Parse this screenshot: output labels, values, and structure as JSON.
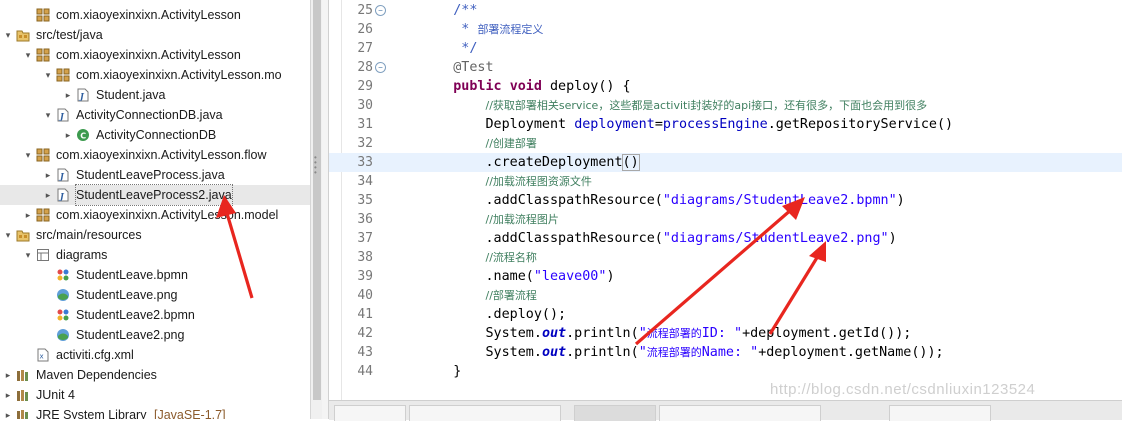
{
  "explorer": {
    "rows": [
      {
        "label": "com.xiaoyexinxixn.ActivityLesson",
        "suffix": "",
        "icon": "package-icon",
        "toggle": ""
      },
      {
        "label": "src/test/java",
        "suffix": "",
        "icon": "source-folder-icon",
        "toggle": "▾"
      },
      {
        "label": "com.xiaoyexinxixn.ActivityLesson",
        "suffix": "",
        "icon": "package-icon",
        "toggle": "▾"
      },
      {
        "label": "com.xiaoyexinxixn.ActivityLesson.mo",
        "suffix": "",
        "icon": "package-icon",
        "toggle": "▾"
      },
      {
        "label": "Student.java",
        "suffix": "",
        "icon": "java-file-icon",
        "toggle": "▸"
      },
      {
        "label": "ActivityConnectionDB.java",
        "suffix": "",
        "icon": "java-file-icon",
        "toggle": "▾"
      },
      {
        "label": "ActivityConnectionDB",
        "suffix": "",
        "icon": "class-icon",
        "toggle": "▸"
      },
      {
        "label": "com.xiaoyexinxixn.ActivityLesson.flow",
        "suffix": "",
        "icon": "package-icon",
        "toggle": "▾"
      },
      {
        "label": "StudentLeaveProcess.java",
        "suffix": "",
        "icon": "java-file-icon",
        "toggle": "▸"
      },
      {
        "label": "StudentLeaveProcess2.java",
        "suffix": "",
        "icon": "java-file-icon",
        "toggle": "▸"
      },
      {
        "label": "com.xiaoyexinxixn.ActivityLesson.model",
        "suffix": "",
        "icon": "package-icon",
        "toggle": "▸"
      },
      {
        "label": "src/main/resources",
        "suffix": "",
        "icon": "source-folder-icon",
        "toggle": "▾"
      },
      {
        "label": "diagrams",
        "suffix": "",
        "icon": "folder-icon",
        "toggle": "▾"
      },
      {
        "label": "StudentLeave.bpmn",
        "suffix": "",
        "icon": "bpmn-file-icon",
        "toggle": ""
      },
      {
        "label": "StudentLeave.png",
        "suffix": "",
        "icon": "image-file-icon",
        "toggle": ""
      },
      {
        "label": "StudentLeave2.bpmn",
        "suffix": "",
        "icon": "bpmn-file-icon",
        "toggle": ""
      },
      {
        "label": "StudentLeave2.png",
        "suffix": "",
        "icon": "image-file-icon",
        "toggle": ""
      },
      {
        "label": "activiti.cfg.xml",
        "suffix": "",
        "icon": "xml-file-icon",
        "toggle": ""
      },
      {
        "label": "Maven Dependencies",
        "suffix": "",
        "icon": "library-icon",
        "toggle": "▸"
      },
      {
        "label": "JUnit 4",
        "suffix": "",
        "icon": "library-icon",
        "toggle": "▸"
      },
      {
        "label": "JRE System Library ",
        "suffix": "[JavaSE-1.7]",
        "icon": "library-icon",
        "toggle": "▸"
      }
    ]
  },
  "editor": {
    "lines": [
      {
        "n": "25",
        "fold": "−",
        "segs": [
          [
            "    ",
            ""
          ],
          [
            "/**",
            "jd"
          ]
        ]
      },
      {
        "n": "26",
        "fold": "",
        "segs": [
          [
            "     * ",
            "jd"
          ],
          [
            "部署流程定义",
            "jd cjk"
          ]
        ]
      },
      {
        "n": "27",
        "fold": "",
        "segs": [
          [
            "     */",
            "jd"
          ]
        ]
      },
      {
        "n": "28",
        "fold": "−",
        "segs": [
          [
            "    ",
            ""
          ],
          [
            "@Test",
            "an"
          ]
        ]
      },
      {
        "n": "29",
        "fold": "",
        "segs": [
          [
            "    ",
            ""
          ],
          [
            "public",
            "kw"
          ],
          [
            " ",
            ""
          ],
          [
            "void",
            "kw"
          ],
          [
            " deploy() {",
            ""
          ]
        ]
      },
      {
        "n": "30",
        "fold": "",
        "segs": [
          [
            "        ",
            ""
          ],
          [
            "//获取部署相关service，这些都是activiti封装好的api接口，还有很多，下面也会用到很多",
            "cm cjk"
          ]
        ]
      },
      {
        "n": "31",
        "fold": "",
        "segs": [
          [
            "        Deployment ",
            ""
          ],
          [
            "deployment",
            "fv"
          ],
          [
            "=",
            ""
          ],
          [
            "processEngine",
            "fv"
          ],
          [
            ".getRepositoryService()",
            ""
          ]
        ]
      },
      {
        "n": "32",
        "fold": "",
        "segs": [
          [
            "        ",
            ""
          ],
          [
            "//创建部署",
            "cm cjk"
          ]
        ]
      },
      {
        "n": "33",
        "fold": "",
        "segs": [
          [
            "        .createDeployment",
            ""
          ],
          [
            "()",
            "bracket"
          ]
        ]
      },
      {
        "n": "34",
        "fold": "",
        "segs": [
          [
            "        ",
            ""
          ],
          [
            "//加载流程图资源文件",
            "cm cjk"
          ]
        ]
      },
      {
        "n": "35",
        "fold": "",
        "segs": [
          [
            "        .addClasspathResource(",
            ""
          ],
          [
            "\"diagrams/StudentLeave2.bpmn\"",
            "st"
          ],
          [
            ")",
            ""
          ]
        ]
      },
      {
        "n": "36",
        "fold": "",
        "segs": [
          [
            "        ",
            ""
          ],
          [
            "//加载流程图片",
            "cm cjk"
          ]
        ]
      },
      {
        "n": "37",
        "fold": "",
        "segs": [
          [
            "        .addClasspathResource(",
            ""
          ],
          [
            "\"diagrams/StudentLeave2.png\"",
            "st"
          ],
          [
            ")",
            ""
          ]
        ]
      },
      {
        "n": "38",
        "fold": "",
        "segs": [
          [
            "        ",
            ""
          ],
          [
            "//流程名称",
            "cm cjk"
          ]
        ]
      },
      {
        "n": "39",
        "fold": "",
        "segs": [
          [
            "        .name(",
            ""
          ],
          [
            "\"leave00\"",
            "st"
          ],
          [
            ")",
            ""
          ]
        ]
      },
      {
        "n": "40",
        "fold": "",
        "segs": [
          [
            "        ",
            ""
          ],
          [
            "//部署流程",
            "cm cjk"
          ]
        ]
      },
      {
        "n": "41",
        "fold": "",
        "segs": [
          [
            "        .deploy();",
            ""
          ]
        ]
      },
      {
        "n": "42",
        "fold": "",
        "segs": [
          [
            "        System.",
            ""
          ],
          [
            "out",
            "st-field"
          ],
          [
            ".println(",
            ""
          ],
          [
            "\"",
            "st"
          ],
          [
            "流程部署的",
            "st cjk"
          ],
          [
            "ID: \"",
            "st"
          ],
          [
            "+deployment.getId());",
            ""
          ]
        ]
      },
      {
        "n": "43",
        "fold": "",
        "segs": [
          [
            "        System.",
            ""
          ],
          [
            "out",
            "st-field"
          ],
          [
            ".println(",
            ""
          ],
          [
            "\"",
            "st"
          ],
          [
            "流程部署的",
            "st cjk"
          ],
          [
            "Name: \"",
            "st"
          ],
          [
            "+deployment.getName());",
            ""
          ]
        ]
      },
      {
        "n": "44",
        "fold": "",
        "segs": [
          [
            "    }",
            ""
          ]
        ]
      }
    ],
    "current_line": 8,
    "watermark": "http://blog.csdn.net/csdnliuxin123524"
  },
  "colors": {
    "arrow": "#e8261f",
    "keyword": "#7f0055",
    "comment": "#3f7f5f",
    "string": "#2a00ff",
    "field": "#0000c0"
  }
}
